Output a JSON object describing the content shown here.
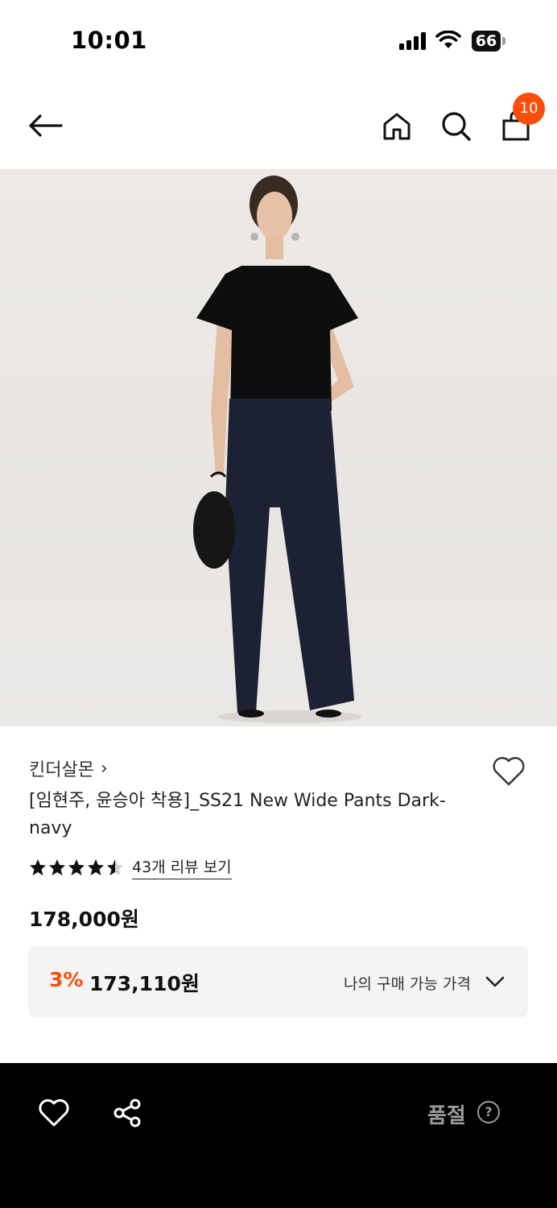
{
  "status_bar": {
    "time": "10:01",
    "battery": "66"
  },
  "header": {
    "cart_count": "10"
  },
  "product": {
    "brand": "킨더살몬",
    "brand_chevron": "›",
    "title": "[임현주, 윤승아 착용]_SS21 New Wide Pants Dark-navy",
    "rating": 4.5,
    "review_link": "43개 리뷰 보기",
    "price": "178,000원",
    "discount_rate": "3%",
    "discount_price": "173,110원",
    "my_price_label": "나의 구매 가능 가격"
  },
  "bottom_bar": {
    "sold_out_label": "품절",
    "help_label": "?"
  },
  "colors": {
    "accent": "#fb4e0b",
    "bar_bg": "#000000",
    "muted": "#9a9a9a"
  },
  "icons": [
    "back-arrow-icon",
    "home-icon",
    "search-icon",
    "shopping-bag-icon",
    "heart-icon",
    "share-icon",
    "chevron-down-icon",
    "star-icon"
  ]
}
